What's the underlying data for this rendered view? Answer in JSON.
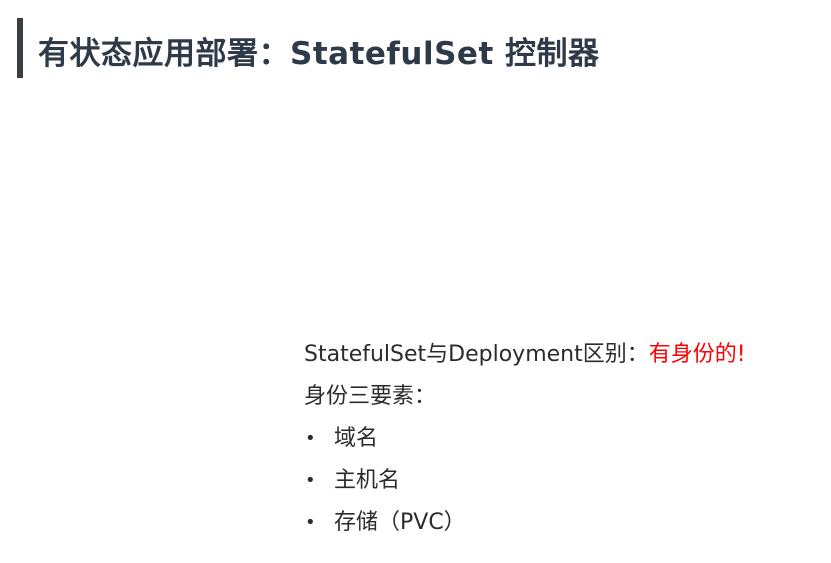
{
  "slide": {
    "title": "有状态应用部署：StatefulSet 控制器"
  },
  "content": {
    "diff_prefix": "StatefulSet与Deployment区别：",
    "diff_highlight": "有身份的!",
    "identity_heading": "身份三要素：",
    "bullet_symbol": "•",
    "items": [
      "域名",
      "主机名",
      "存储（PVC）"
    ]
  },
  "colors": {
    "title": "#2e3a48",
    "accent_bar": "#3a3f46",
    "highlight": "#ff0000",
    "body_text": "#2b2b2b"
  }
}
